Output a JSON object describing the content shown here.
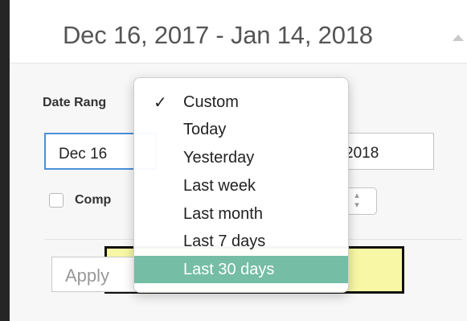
{
  "header": {
    "range_text": "Dec 16, 2017 - Jan 14, 2018",
    "caret_icon": "triangle-up"
  },
  "form": {
    "date_range_label": "Date Rang",
    "start_date_value": "Dec 16",
    "end_date_value": "2018",
    "compare_label": "Comp",
    "compare_checked": false,
    "apply_label": "Apply"
  },
  "menu": {
    "checkmark": "✓",
    "items": [
      {
        "label": "Custom",
        "checked": true
      },
      {
        "label": "Today"
      },
      {
        "label": "Yesterday"
      },
      {
        "label": "Last week"
      },
      {
        "label": "Last month"
      },
      {
        "label": "Last 7 days"
      },
      {
        "label": "Last 30 days",
        "highlighted": true
      }
    ]
  },
  "colors": {
    "selection": "#75bda5",
    "annotation_fill": "#f7f7a6",
    "annotation_border": "#111111",
    "focus_border": "#4a90d9"
  }
}
